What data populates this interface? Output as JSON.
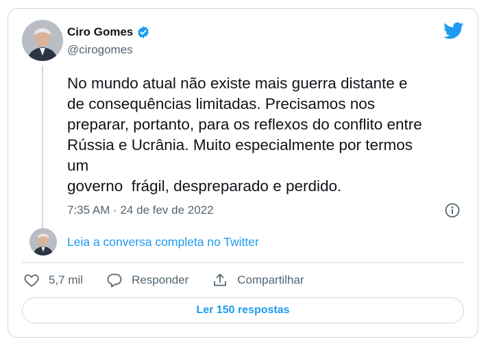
{
  "author": {
    "name": "Ciro Gomes",
    "handle": "@cirogomes",
    "verified": true
  },
  "tweet": {
    "text": "No mundo atual não existe mais guerra distante e\nde consequências limitadas. Precisamos nos\npreparar, portanto, para os reflexos do conflito entre\nRússia e Ucrânia. Muito especialmente por termos\num\ngoverno  frágil, despreparado e perdido.",
    "timestamp": "7:35 AM · 24 de fev de 2022"
  },
  "read_conversation_label": "Leia a conversa completa no Twitter",
  "actions": {
    "likes_count": "5,7 mil",
    "reply_label": "Responder",
    "share_label": "Compartilhar"
  },
  "replies_button_label": "Ler 150 respostas",
  "icons": {
    "brand": "twitter-bird-icon",
    "verified": "verified-badge-icon",
    "info": "info-icon",
    "like": "heart-icon",
    "reply": "reply-bubble-icon",
    "share": "share-upload-icon"
  },
  "colors": {
    "accent": "#1d9bf0",
    "text_primary": "#0f1419",
    "text_secondary": "#536471",
    "border": "#cfd9de"
  }
}
